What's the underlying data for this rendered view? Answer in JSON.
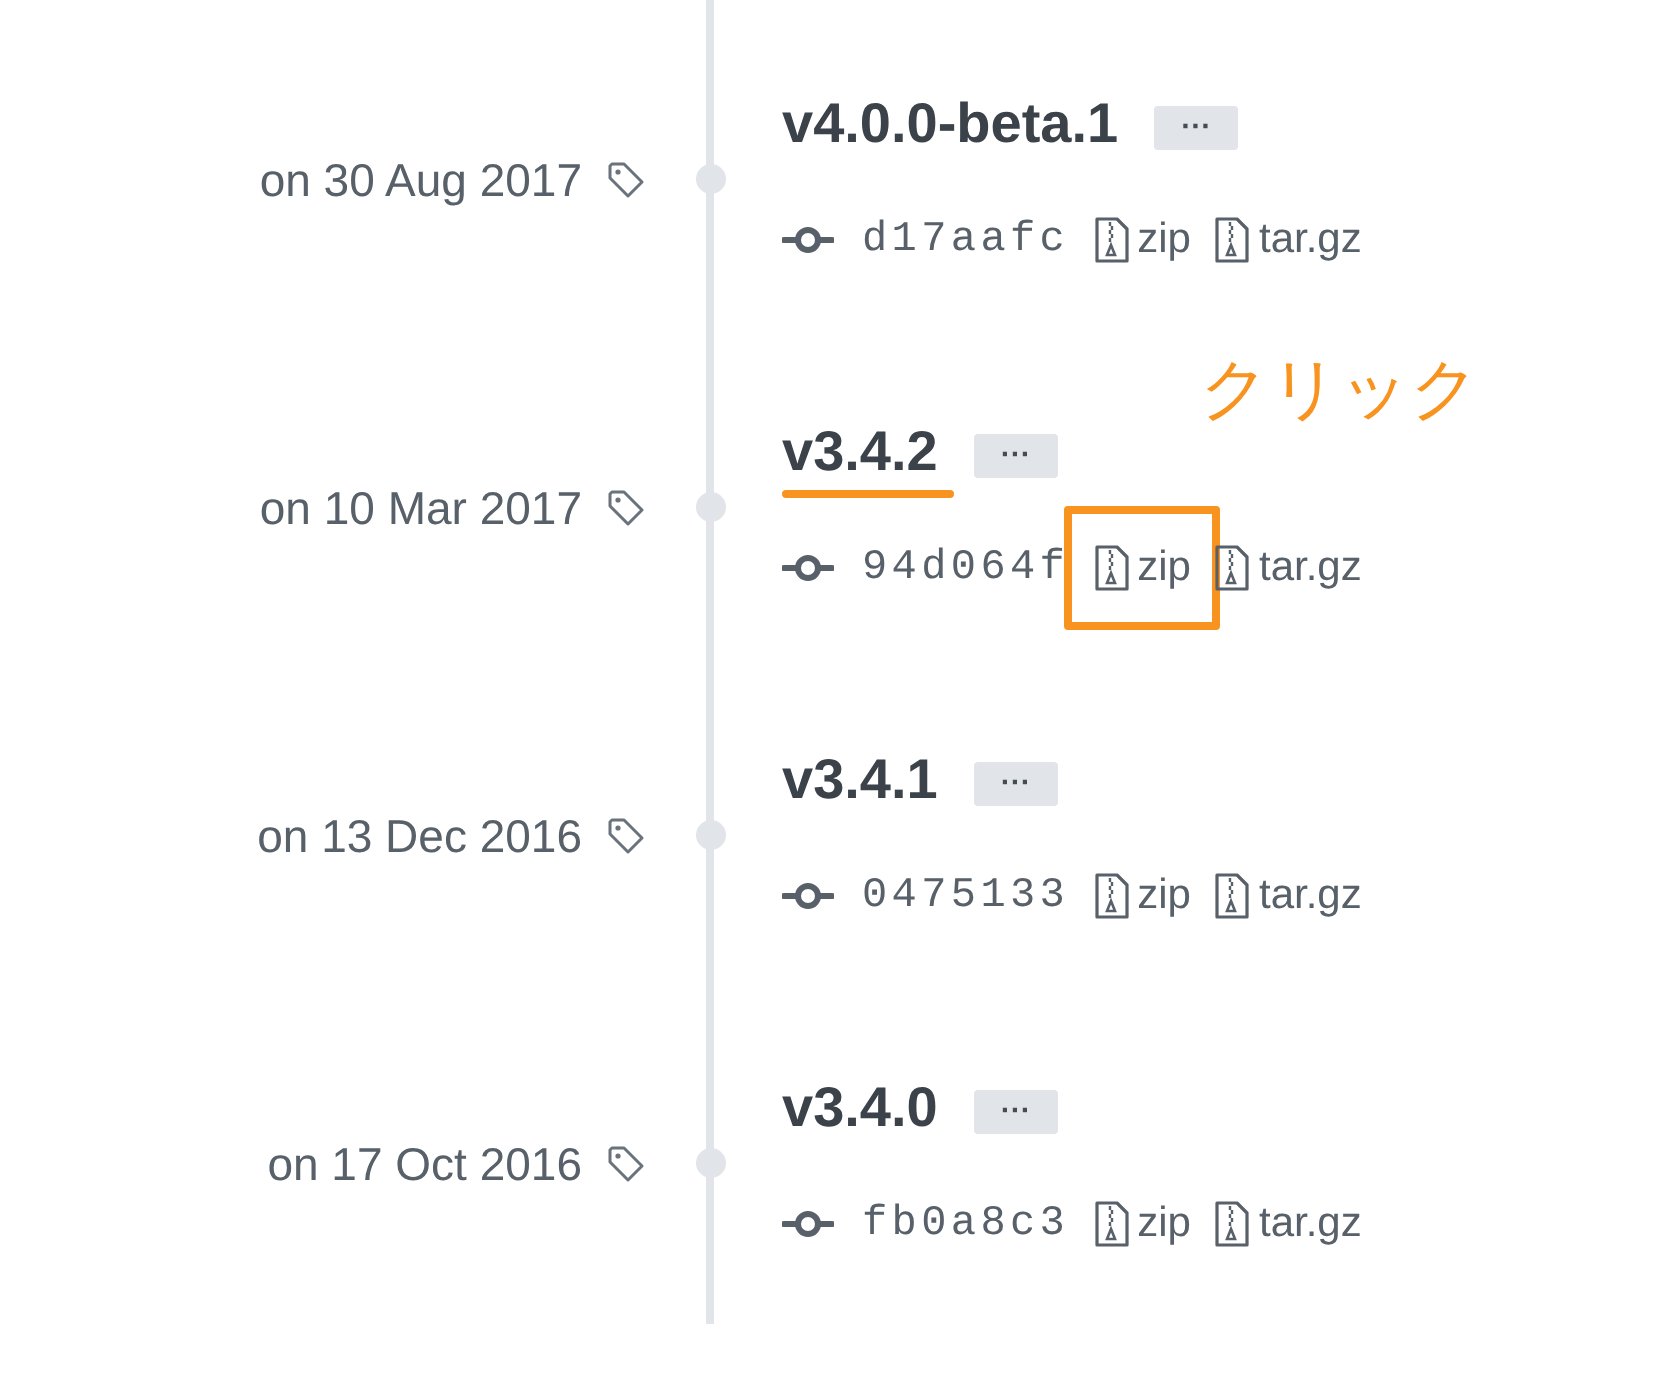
{
  "releases": [
    {
      "date": "on 30 Aug 2017",
      "name": "v4.0.0-beta.1",
      "more": "···",
      "commit": "d17aafc",
      "title_underlined": false,
      "downloads": [
        {
          "label": "zip",
          "highlighted": false
        },
        {
          "label": "tar.gz",
          "highlighted": false
        }
      ]
    },
    {
      "date": "on 10 Mar 2017",
      "name": "v3.4.2",
      "more": "···",
      "commit": "94d064f",
      "title_underlined": true,
      "annotation": "クリック",
      "downloads": [
        {
          "label": "zip",
          "highlighted": true
        },
        {
          "label": "tar.gz",
          "highlighted": false
        }
      ]
    },
    {
      "date": "on 13 Dec 2016",
      "name": "v3.4.1",
      "more": "···",
      "commit": "0475133",
      "title_underlined": false,
      "downloads": [
        {
          "label": "zip",
          "highlighted": false
        },
        {
          "label": "tar.gz",
          "highlighted": false
        }
      ]
    },
    {
      "date": "on 17 Oct 2016",
      "name": "v3.4.0",
      "more": "···",
      "commit": "fb0a8c3",
      "title_underlined": false,
      "downloads": [
        {
          "label": "zip",
          "highlighted": false
        },
        {
          "label": "tar.gz",
          "highlighted": false
        }
      ]
    }
  ]
}
